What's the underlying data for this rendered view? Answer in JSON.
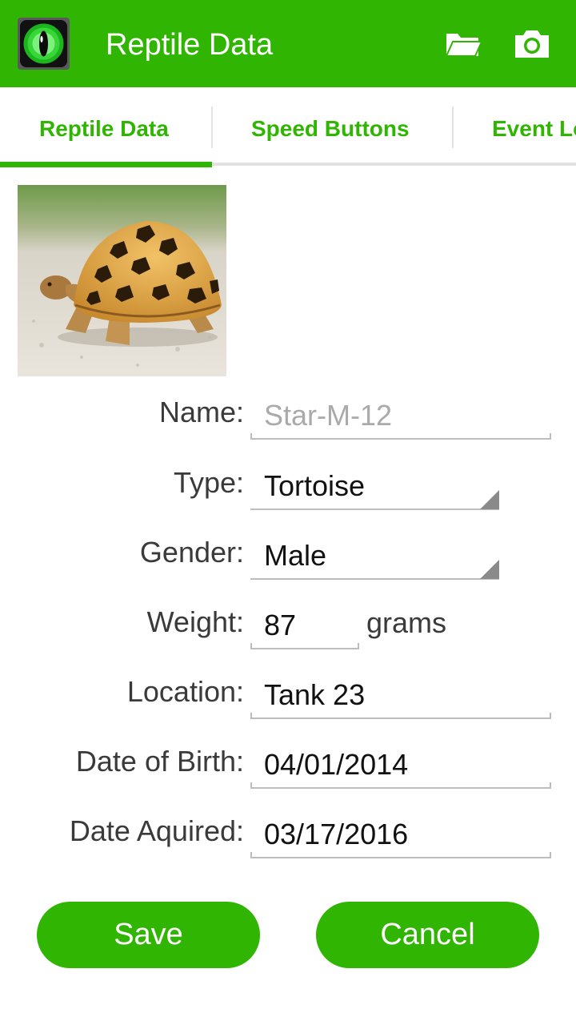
{
  "app_bar": {
    "title": "Reptile Data",
    "icons": [
      "reptile-eye-app-icon",
      "folder-open-icon",
      "camera-icon"
    ],
    "color": "#2fb502"
  },
  "tabs": [
    {
      "label": "Reptile Data",
      "selected": true
    },
    {
      "label": "Speed Buttons",
      "selected": false
    },
    {
      "label": "Event Lo",
      "selected": false
    }
  ],
  "form": {
    "name": {
      "label": "Name:",
      "placeholder": "Star-M-12",
      "value": ""
    },
    "type": {
      "label": "Type:",
      "value": "Tortoise"
    },
    "gender": {
      "label": "Gender:",
      "value": "Male"
    },
    "weight": {
      "label": "Weight:",
      "value": "87",
      "unit": "grams"
    },
    "location": {
      "label": "Location:",
      "value": "Tank 23"
    },
    "dob": {
      "label": "Date of Birth:",
      "value": "04/01/2014"
    },
    "acquired": {
      "label": "Date Aquired:",
      "value": "03/17/2016"
    }
  },
  "buttons": {
    "save": "Save",
    "cancel": "Cancel"
  },
  "colors": {
    "accent": "#2fb502",
    "text": "#3a3a3a",
    "hint": "#aaaaaa"
  }
}
